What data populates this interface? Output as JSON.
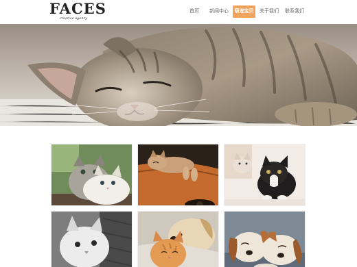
{
  "site": {
    "logo_text": "FACES",
    "logo_tagline": "creative agency"
  },
  "nav": {
    "items": [
      {
        "label": "首页",
        "active": false
      },
      {
        "label": "新闻中心",
        "active": false
      },
      {
        "label": "萌宠宝贝",
        "active": true
      },
      {
        "label": "关于我们",
        "active": false
      },
      {
        "label": "联系我们",
        "active": false
      }
    ]
  },
  "banner": {
    "subject": "sleeping-tabby-kitten"
  },
  "gallery": {
    "tiles": [
      {
        "subject": "two-kittens-white-tabby"
      },
      {
        "subject": "kitten-on-guitar"
      },
      {
        "subject": "black-and-white-kitten"
      },
      {
        "subject": "white-kitten-blanket"
      },
      {
        "subject": "kitten-and-dog-cuddle"
      },
      {
        "subject": "two-beagle-puppies-sleeping"
      }
    ]
  },
  "colors": {
    "accent": "#f0a35c",
    "nav_text": "#666666"
  }
}
